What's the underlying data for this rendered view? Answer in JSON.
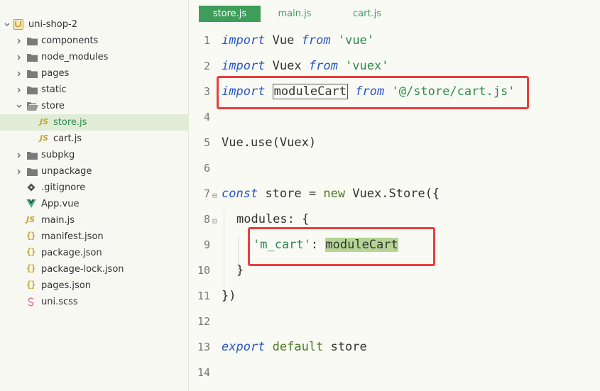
{
  "sidebar": {
    "root": "uni-shop-2",
    "items": [
      {
        "label": "components",
        "kind": "folder",
        "expanded": false
      },
      {
        "label": "node_modules",
        "kind": "folder",
        "expanded": false
      },
      {
        "label": "pages",
        "kind": "folder",
        "expanded": false
      },
      {
        "label": "static",
        "kind": "folder",
        "expanded": false
      },
      {
        "label": "store",
        "kind": "folder",
        "expanded": true
      },
      {
        "label": "store.js",
        "kind": "js",
        "selected": true
      },
      {
        "label": "cart.js",
        "kind": "js"
      },
      {
        "label": "subpkg",
        "kind": "folder",
        "expanded": false
      },
      {
        "label": "unpackage",
        "kind": "folder",
        "expanded": false
      },
      {
        "label": ".gitignore",
        "kind": "git"
      },
      {
        "label": "App.vue",
        "kind": "vue"
      },
      {
        "label": "main.js",
        "kind": "js"
      },
      {
        "label": "manifest.json",
        "kind": "json"
      },
      {
        "label": "package.json",
        "kind": "json"
      },
      {
        "label": "package-lock.json",
        "kind": "json"
      },
      {
        "label": "pages.json",
        "kind": "json"
      },
      {
        "label": "uni.scss",
        "kind": "scss"
      }
    ]
  },
  "tabs": [
    {
      "label": "store.js",
      "active": true
    },
    {
      "label": "main.js",
      "active": false
    },
    {
      "label": "cart.js",
      "active": false
    }
  ],
  "editor": {
    "line_numbers": [
      "1",
      "2",
      "3",
      "4",
      "5",
      "6",
      "7",
      "8",
      "9",
      "10",
      "11",
      "12",
      "13",
      "14"
    ],
    "code": {
      "l1": {
        "kw": "import",
        "name": "Vue",
        "from": "from",
        "str": "'vue'"
      },
      "l2": {
        "kw": "import",
        "name": "Vuex",
        "from": "from",
        "str": "'vuex'"
      },
      "l3": {
        "kw": "import",
        "name": "moduleCart",
        "from": "from",
        "str": "'@/store/cart.js'"
      },
      "l5": {
        "text": "Vue.use(Vuex)"
      },
      "l7": {
        "const": "const",
        "mid": "store =",
        "new": "new",
        "rest": "Vuex.Store({"
      },
      "l8": {
        "text": "modules: {"
      },
      "l9": {
        "str": "'m_cart'",
        "colon": ":",
        "name": "moduleCart"
      },
      "l10": {
        "text": "}"
      },
      "l11": {
        "text": "})"
      },
      "l13": {
        "export": "export",
        "default": "default",
        "name": "store"
      }
    }
  },
  "colors": {
    "accent_green": "#3f9d5b",
    "keyword_blue": "#2556c5",
    "string_green": "#2c8a4c",
    "annotation_red": "#e8403a",
    "highlight_green": "#b5d595"
  },
  "icons": {
    "root": "project-u-icon",
    "folder": "folder-icon",
    "js": "js-file-icon",
    "json": "json-file-icon",
    "vue": "vue-file-icon",
    "git": "git-file-icon",
    "scss": "scss-file-icon"
  }
}
